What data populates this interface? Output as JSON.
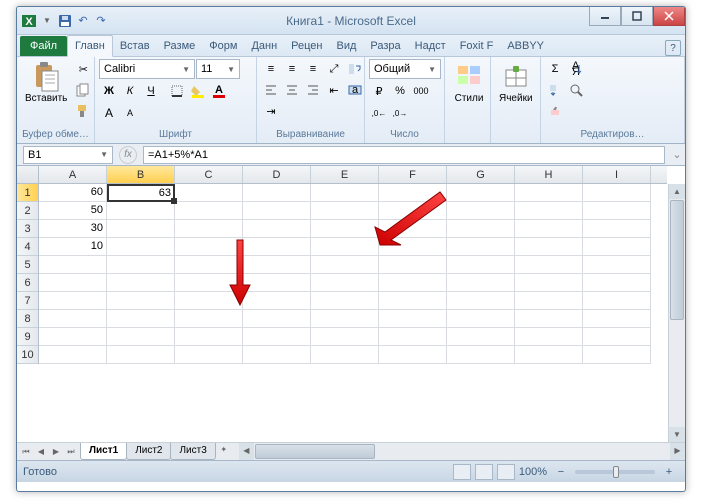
{
  "title": "Книга1 - Microsoft Excel",
  "tabs": {
    "file": "Файл",
    "home": "Главн",
    "insert": "Встав",
    "layout": "Разме",
    "formulas": "Форм",
    "data": "Данн",
    "review": "Рецен",
    "view": "Вид",
    "dev": "Разра",
    "addins": "Надст",
    "foxit": "Foxit F",
    "abbyy": "ABBYY"
  },
  "groups": {
    "clipboard": "Буфер обме…",
    "font": "Шрифт",
    "align": "Выравнивание",
    "number": "Число",
    "styles": "Стили",
    "cells": "Ячейки",
    "editing": "Редактиров…"
  },
  "paste": "Вставить",
  "font": {
    "name": "Calibri",
    "size": "11"
  },
  "numfmt": "Общий",
  "styles": "Стили",
  "cells_btn": "Ячейки",
  "namebox": "B1",
  "formula": "=A1+5%*A1",
  "cols": [
    "A",
    "B",
    "C",
    "D",
    "E",
    "F",
    "G",
    "H",
    "I"
  ],
  "rows": [
    "1",
    "2",
    "3",
    "4",
    "5",
    "6",
    "7",
    "8",
    "9",
    "10"
  ],
  "data": {
    "A1": "60",
    "A2": "50",
    "A3": "30",
    "A4": "10",
    "B1": "63"
  },
  "sheets": [
    "Лист1",
    "Лист2",
    "Лист3"
  ],
  "status": "Готово",
  "zoom": "100%"
}
